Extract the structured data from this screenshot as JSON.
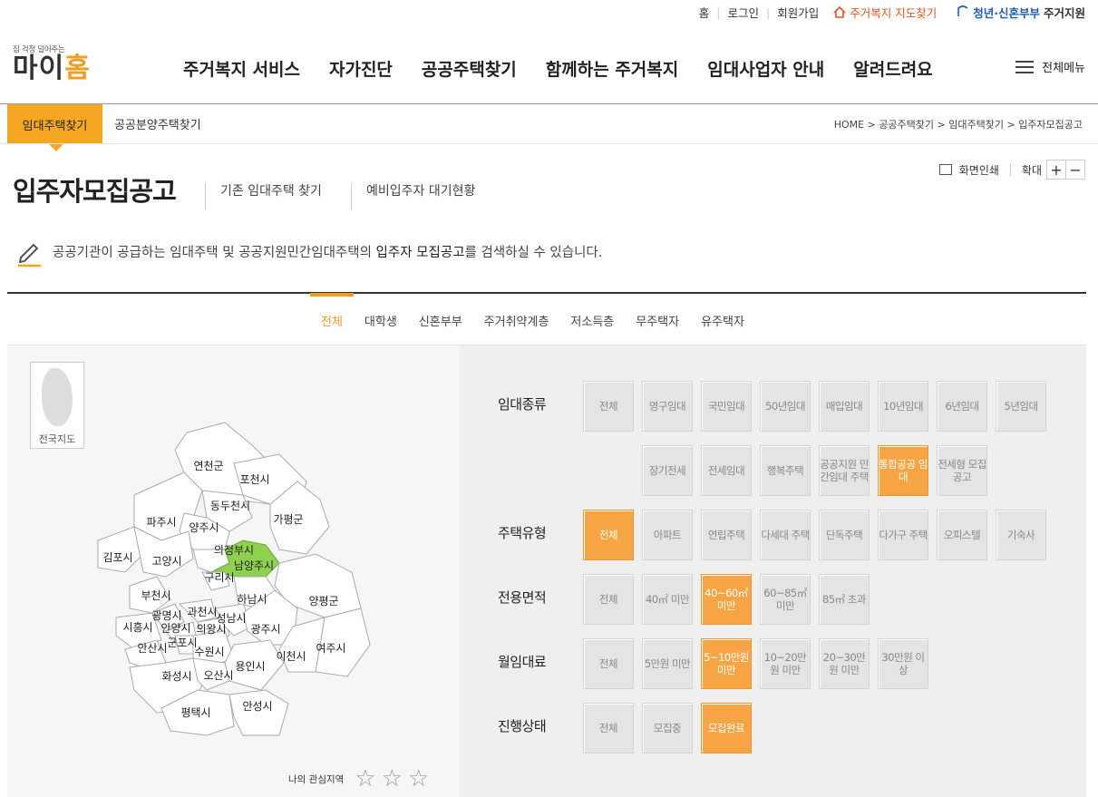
{
  "util": {
    "home": "홈",
    "login": "로그인",
    "join": "회원가입",
    "map": "주거복지 지도찾기",
    "youth_a": "청년·신혼부부",
    "youth_b": "주거지원"
  },
  "logo": {
    "tagline": "집 걱정 덜어주는",
    "name_a": "마이",
    "name_b": "홈"
  },
  "gnb": [
    "주거복지 서비스",
    "자가진단",
    "공공주택찾기",
    "함께하는 주거복지",
    "임대사업자 안내",
    "알려드려요"
  ],
  "all_menu": "전체메뉴",
  "subnav": {
    "active": "임대주택찾기",
    "other": "공공분양주택찾기"
  },
  "breadcrumb": "HOME > 공공주택찾기 > 임대주택찾기 > 입주자모집공고",
  "page": {
    "title": "입주자모집공고",
    "link1": "기존 임대주택 찾기",
    "link2": "예비입주자 대기현황"
  },
  "tools": {
    "print": "화면인쇄",
    "zoom": "확대",
    "plus": "+",
    "minus": "−"
  },
  "desc": {
    "pre": "공공기관이 공급하는 임대주택 및 공공지원민간임대주택의 ",
    "mid": "입주자 모집공고",
    "post": "를 검색하실 수 있습니다."
  },
  "cat_tabs": [
    "전체",
    "대학생",
    "신혼부부",
    "주거취약계층",
    "저소득층",
    "무주택자",
    "유주택자"
  ],
  "map": {
    "nation_label": "전국지도",
    "favorites_label": "나의 관심지역",
    "stars": [
      "1",
      "2",
      "3"
    ],
    "regions": [
      "연천군",
      "포천시",
      "동두천시",
      "파주시",
      "양주시",
      "가평군",
      "김포시",
      "고양시",
      "의정부시",
      "남양주시",
      "구리시",
      "양평군",
      "부천시",
      "하남시",
      "광명시",
      "과천시",
      "시흥시",
      "안양시",
      "의왕시",
      "성남시",
      "광주시",
      "안산시",
      "군포시",
      "수원시",
      "여주시",
      "이천시",
      "용인시",
      "화성시",
      "오산시",
      "평택시",
      "안성시"
    ],
    "selected": "남양주시",
    "selected_color": "#8fd14f"
  },
  "filters": {
    "rent_type": {
      "label": "임대종류",
      "options": [
        "전체",
        "영구임대",
        "국민임대",
        "50년임대",
        "매입임대",
        "10년임대",
        "6년임대",
        "5년임대",
        "장기전세",
        "전세임대",
        "행복주택",
        "공공지원 민간임대 주택",
        "통합공공 임대",
        "전세형 모집공고"
      ],
      "selected": "통합공공 임대"
    },
    "house_type": {
      "label": "주택유형",
      "options": [
        "전체",
        "아파트",
        "연립주택",
        "다세대 주택",
        "단독주택",
        "다가구 주택",
        "오피스텔",
        "기숙사"
      ],
      "selected": "전체"
    },
    "area": {
      "label": "전용면적",
      "options": [
        "전체",
        "40㎡ 미만",
        "40~60㎡ 미만",
        "60~85㎡ 미만",
        "85㎡ 초과"
      ],
      "selected": "40~60㎡ 미만"
    },
    "monthly": {
      "label": "월임대료",
      "options": [
        "전체",
        "5만원 미만",
        "5~10만원 미만",
        "10~20만원 미만",
        "20~30만원 미만",
        "30만원 이상"
      ],
      "selected": "5~10만원 미만"
    },
    "status": {
      "label": "진행상태",
      "options": [
        "전체",
        "모집중",
        "모집완료"
      ],
      "selected": "모집완료"
    }
  },
  "colors": {
    "accent": "#f5a623",
    "button_on": "#f7a444",
    "button_off": "#e4e4e4"
  }
}
